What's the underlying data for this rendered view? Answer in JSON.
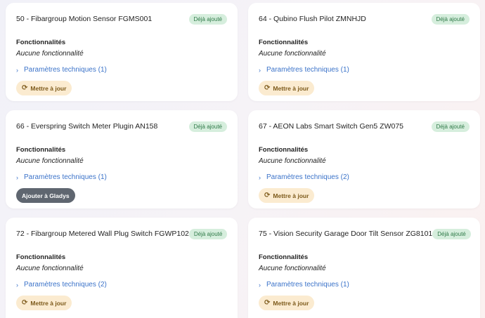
{
  "cards": [
    {
      "title": "50 - Fibargroup Motion Sensor FGMS001",
      "badge": "Déjà ajouté",
      "features_label": "Fonctionnalités",
      "features_value": "Aucune fonctionnalité",
      "params": "Paramètres techniques (1)",
      "button": "Mettre à jour"
    },
    {
      "title": "64 - Qubino Flush Pilot ZMNHJD",
      "badge": "Déjà ajouté",
      "features_label": "Fonctionnalités",
      "features_value": "Aucune fonctionnalité",
      "params": "Paramètres techniques (1)",
      "button": "Mettre à jour"
    },
    {
      "title": "66 - Everspring Switch Meter Plugin AN158",
      "badge": "Déjà ajouté",
      "features_label": "Fonctionnalités",
      "features_value": "Aucune fonctionnalité",
      "params": "Paramètres techniques (1)",
      "button": "Ajouter à Gladys"
    },
    {
      "title": "67 - AEON Labs Smart Switch Gen5 ZW075",
      "badge": "Déjà ajouté",
      "features_label": "Fonctionnalités",
      "features_value": "Aucune fonctionnalité",
      "params": "Paramètres techniques (2)",
      "button": "Mettre à jour"
    },
    {
      "title": "72 - Fibargroup Metered Wall Plug Switch FGWP102",
      "badge": "Déjà ajouté",
      "features_label": "Fonctionnalités",
      "features_value": "Aucune fonctionnalité",
      "params": "Paramètres techniques (2)",
      "button": "Mettre à jour"
    },
    {
      "title": "75 - Vision Security Garage Door Tilt Sensor ZG8101",
      "badge": "Déjà ajouté",
      "features_label": "Fonctionnalités",
      "features_value": "Aucune fonctionnalité",
      "params": "Paramètres techniques (1)",
      "button": "Mettre à jour"
    }
  ],
  "icons": {
    "params_chevron": "chevron-right-icon",
    "update_button": "refresh-icon"
  },
  "colors": {
    "badge_bg": "#d6eedd",
    "badge_text": "#2f7a48",
    "link": "#3b73c9",
    "update_button_bg": "#fbebd0",
    "add_button_bg": "#5f6670"
  }
}
